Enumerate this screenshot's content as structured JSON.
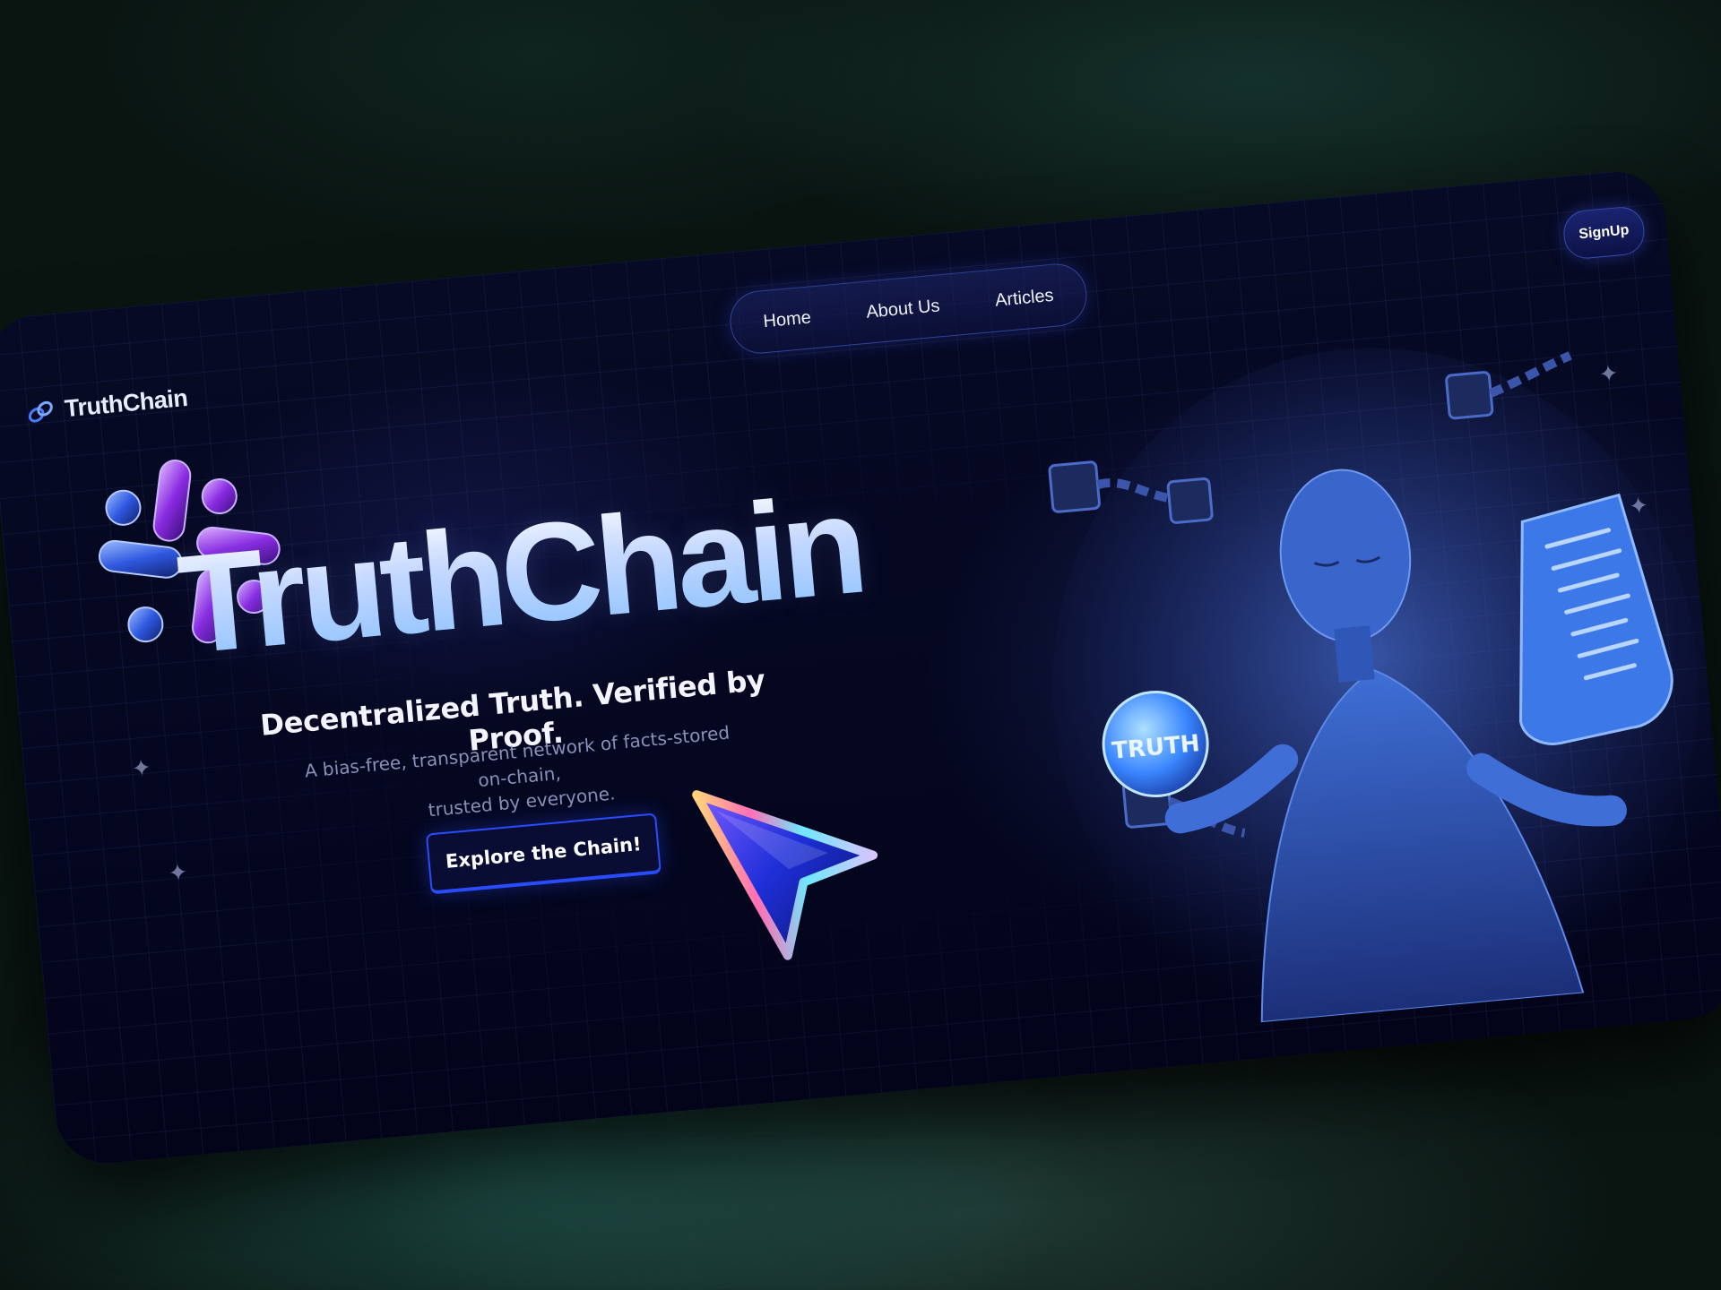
{
  "brand": {
    "name": "TruthChain",
    "logo_icon": "chain-link-icon"
  },
  "nav": {
    "items": [
      "Home",
      "About Us",
      "Articles"
    ]
  },
  "signup": {
    "label": "SignUp"
  },
  "hero": {
    "title": "TruthChain",
    "tagline": "Decentralized Truth. Verified by Proof.",
    "subtitle_line1": "A bias-free, transparent network of facts-stored on-chain,",
    "subtitle_line2": "trusted by everyone.",
    "cta_label": "Explore the Chain!",
    "graphic_icon": "glass-capsules-icon",
    "pointer_icon": "cursor-arrow-icon"
  },
  "illustration": {
    "orb_text": "TRUTH",
    "figure": "robot-figure-icon",
    "scroll": "document-scroll-icon",
    "chains": "chain-blocks-icon"
  },
  "colors": {
    "accent": "#2a4cff",
    "background": "#050720",
    "title_gradient_end": "#8ec4ff"
  }
}
